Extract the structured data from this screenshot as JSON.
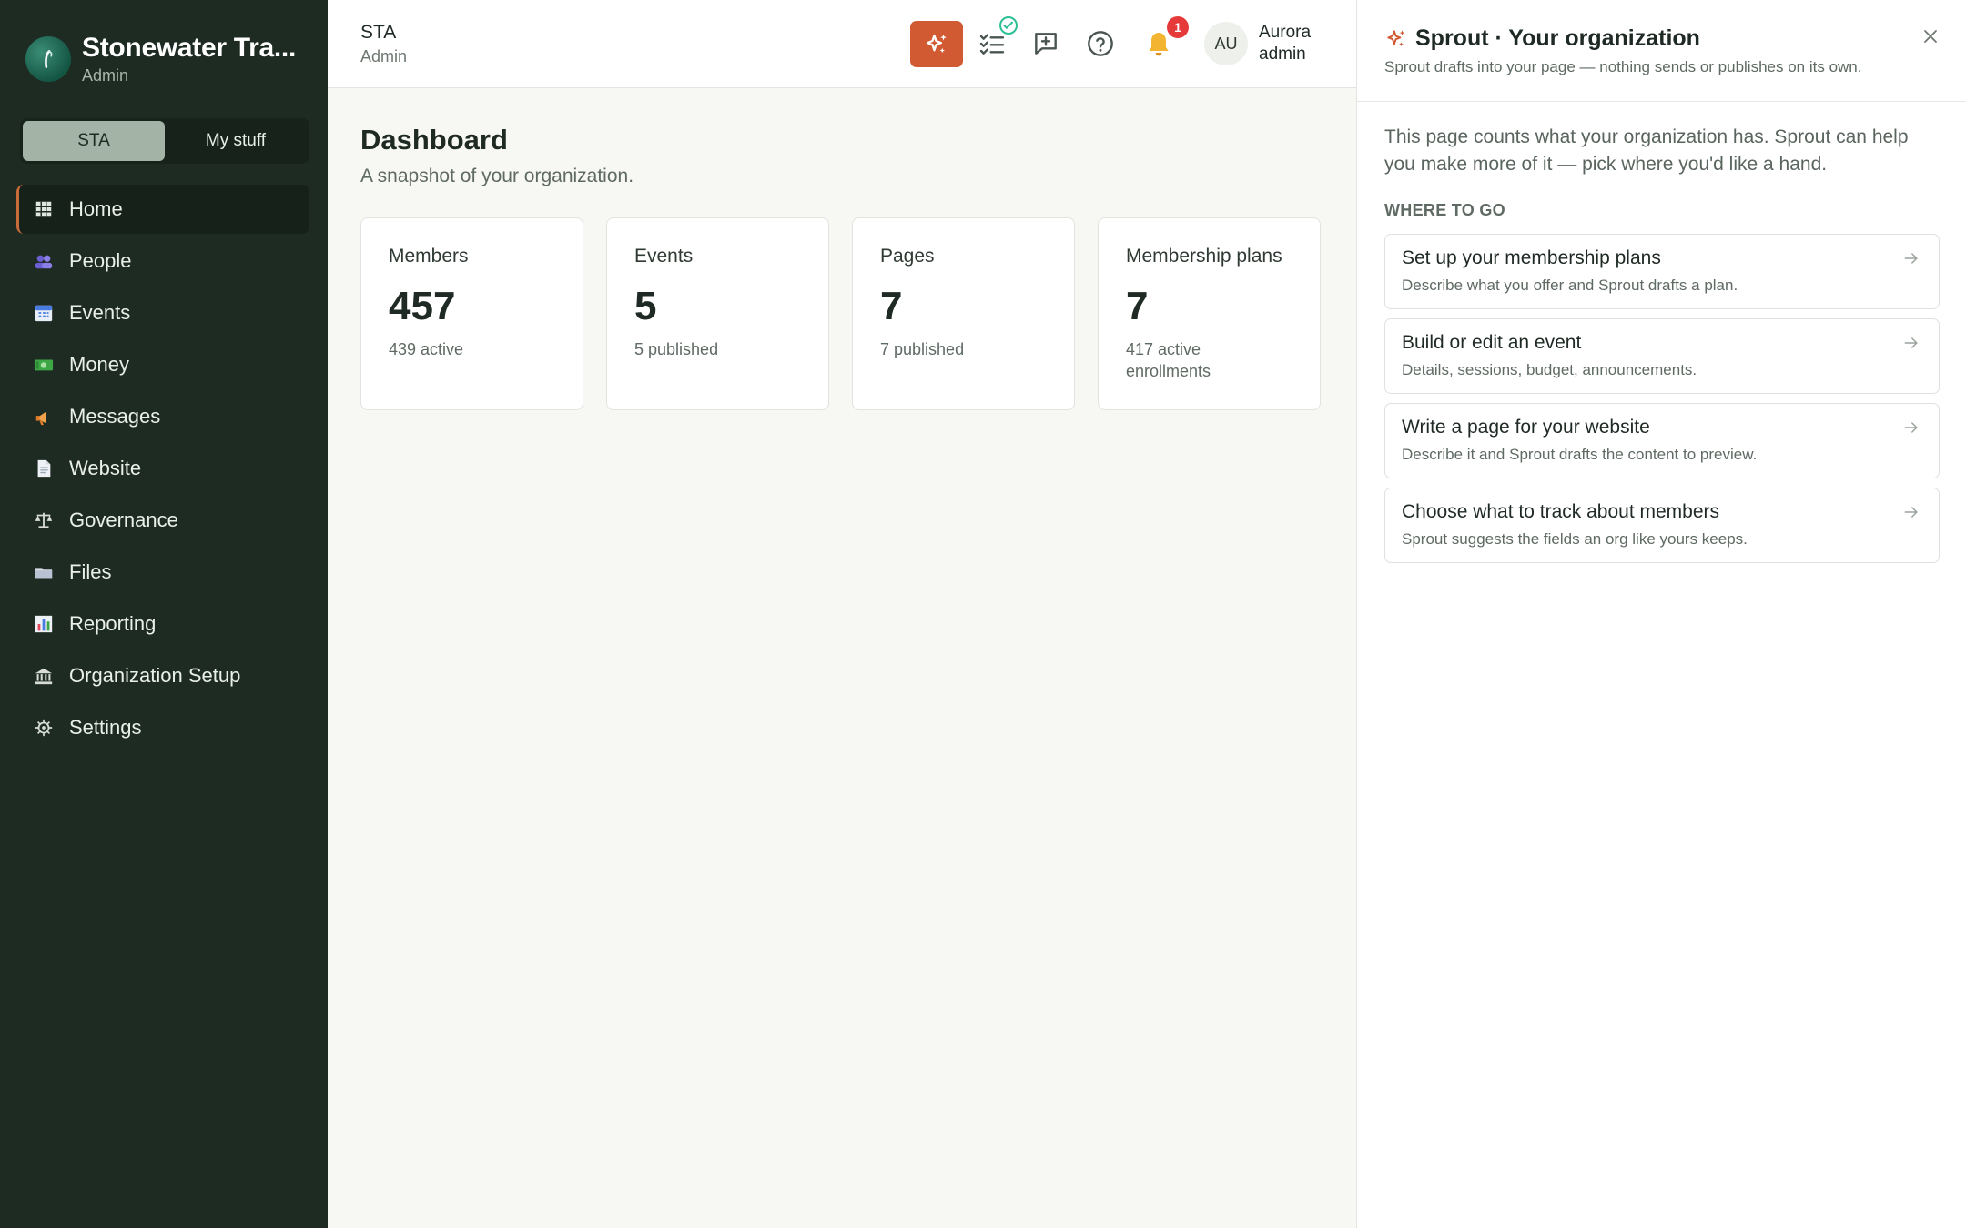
{
  "sidebar": {
    "brand_title": "Stonewater Tra...",
    "brand_role": "Admin",
    "switcher": [
      "STA",
      "My stuff"
    ],
    "active_switch": "STA",
    "items": [
      {
        "label": "Home",
        "icon": "grid-icon",
        "active": true
      },
      {
        "label": "People",
        "icon": "people-icon"
      },
      {
        "label": "Events",
        "icon": "calendar-icon"
      },
      {
        "label": "Money",
        "icon": "money-icon"
      },
      {
        "label": "Messages",
        "icon": "megaphone-icon"
      },
      {
        "label": "Website",
        "icon": "document-icon"
      },
      {
        "label": "Governance",
        "icon": "scales-icon"
      },
      {
        "label": "Files",
        "icon": "folder-icon"
      },
      {
        "label": "Reporting",
        "icon": "bar-chart-icon"
      },
      {
        "label": "Organization Setup",
        "icon": "building-icon"
      },
      {
        "label": "Settings",
        "icon": "gear-icon"
      }
    ]
  },
  "topbar": {
    "org_code": "STA",
    "org_role": "Admin",
    "notification_count": "1",
    "avatar_initials": "AU",
    "user_name": "Aurora",
    "user_role": "admin",
    "accent_color": "#d25a32"
  },
  "main": {
    "title": "Dashboard",
    "subtitle": "A snapshot of your organization.",
    "cards": [
      {
        "label": "Members",
        "value": "457",
        "note": "439 active"
      },
      {
        "label": "Events",
        "value": "5",
        "note": "5 published"
      },
      {
        "label": "Pages",
        "value": "7",
        "note": "7 published"
      },
      {
        "label": "Membership plans",
        "value": "7",
        "note": "417 active enrollments"
      }
    ]
  },
  "panel": {
    "title": "Sprout · Your organization",
    "subtitle": "Sprout drafts into your page — nothing sends or publishes on its own.",
    "intro": "This page counts what your organization has. Sprout can help you make more of it — pick where you'd like a hand.",
    "section_label": "WHERE TO GO",
    "actions": [
      {
        "title": "Set up your membership plans",
        "desc": "Describe what you offer and Sprout drafts a plan."
      },
      {
        "title": "Build or edit an event",
        "desc": "Details, sessions, budget, announcements."
      },
      {
        "title": "Write a page for your website",
        "desc": "Describe it and Sprout drafts the content to preview."
      },
      {
        "title": "Choose what to track about members",
        "desc": "Sprout suggests the fields an org like yours keeps."
      }
    ]
  }
}
